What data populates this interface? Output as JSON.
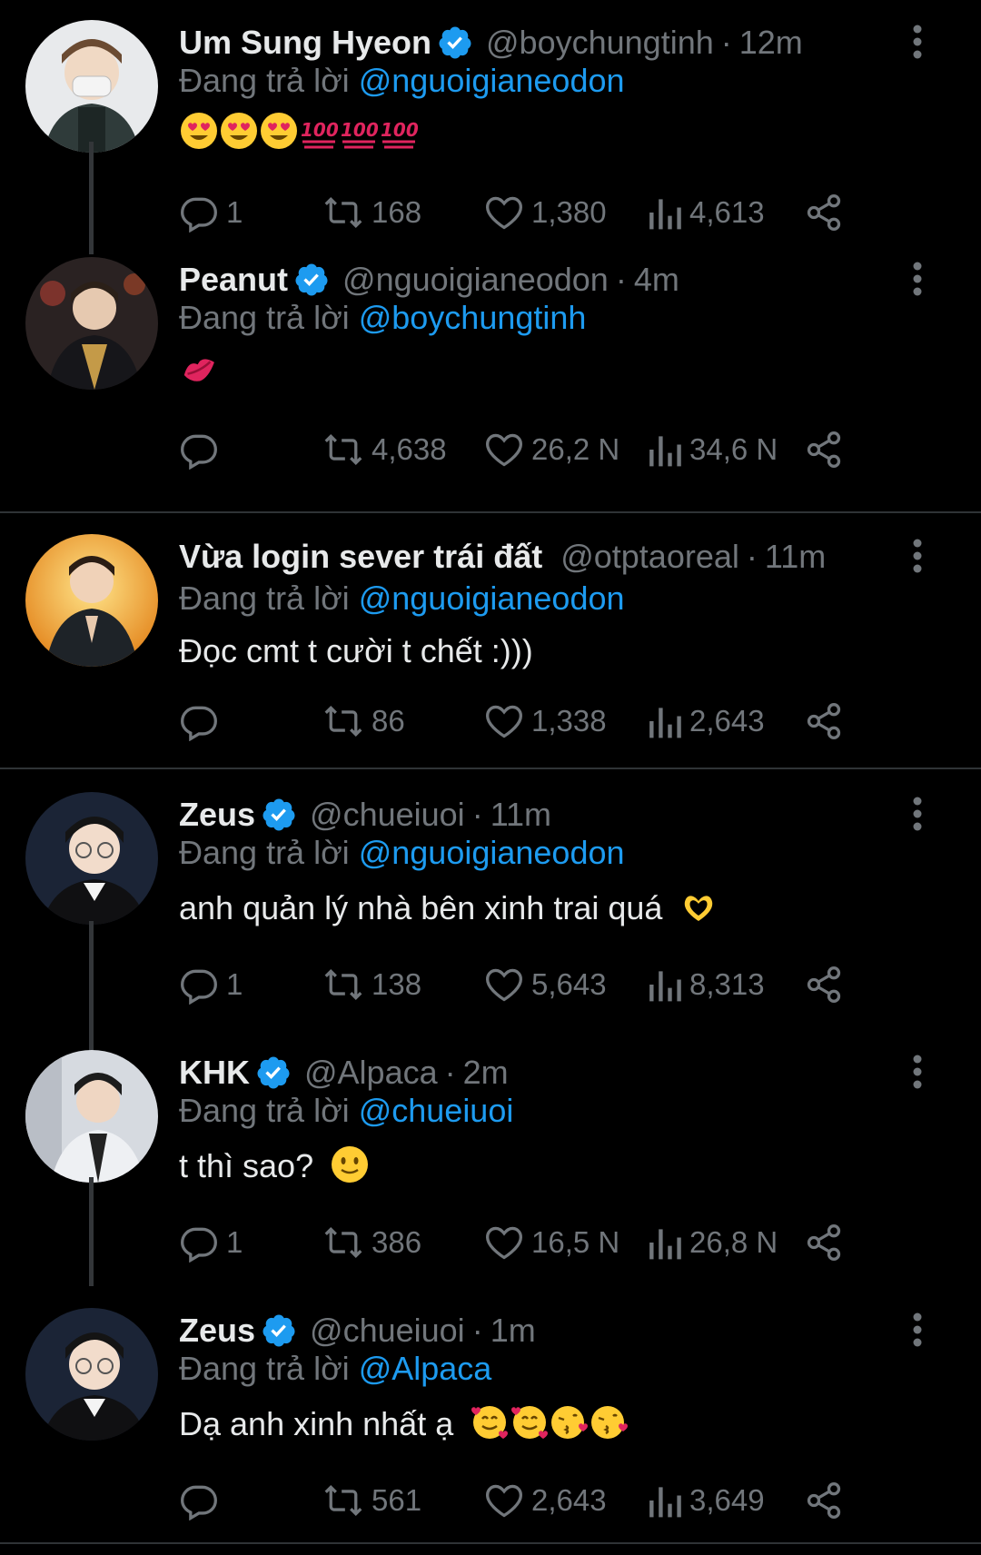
{
  "tweets": [
    {
      "name": "Um Sung Hyeon",
      "verified": true,
      "handle": "@boychungtinh",
      "sep": "·",
      "time": "12m",
      "replying_prefix": "Đang trả lời",
      "replying_to": "@nguoigianeodon",
      "content": "",
      "content_emojis": [
        "heart-eyes",
        "heart-eyes",
        "heart-eyes",
        "hundred",
        "hundred",
        "hundred"
      ],
      "replies": "1",
      "retweets": "168",
      "likes": "1,380",
      "views": "4,613",
      "avatar_color": "#cfd3d6"
    },
    {
      "name": "Peanut",
      "verified": true,
      "handle": "@nguoigianeodon",
      "sep": "·",
      "time": "4m",
      "replying_prefix": "Đang trả lời",
      "replying_to": "@boychungtinh",
      "content": "",
      "content_emojis": [
        "kiss-lips"
      ],
      "replies": "",
      "retweets": "4,638",
      "likes": "26,2 N",
      "views": "34,6 N",
      "avatar_color": "#3a2f2c"
    },
    {
      "name": "Vừa login sever trái đất",
      "verified": false,
      "handle": "@otptaoreal",
      "sep": "·",
      "time": "11m",
      "replying_prefix": "Đang trả lời",
      "replying_to": "@nguoigianeodon",
      "content": "Đọc cmt t cười t chết :)))",
      "content_emojis": [],
      "replies": "",
      "retweets": "86",
      "likes": "1,338",
      "views": "2,643",
      "avatar_color": "#e9a12a"
    },
    {
      "name": "Zeus",
      "verified": true,
      "handle": "@chueiuoi",
      "sep": "·",
      "time": "11m",
      "replying_prefix": "Đang trả lời",
      "replying_to": "@nguoigianeodon",
      "content": "anh quản lý nhà bên xinh trai quá",
      "content_emojis": [
        "heart-hands"
      ],
      "replies": "1",
      "retweets": "138",
      "likes": "5,643",
      "views": "8,313",
      "avatar_color": "#1f2a3d"
    },
    {
      "name": "KHK",
      "verified": true,
      "handle": "@Alpaca",
      "sep": "·",
      "time": "2m",
      "replying_prefix": "Đang trả lời",
      "replying_to": "@chueiuoi",
      "content": "t thì sao?",
      "content_emojis": [
        "slight-smile"
      ],
      "replies": "1",
      "retweets": "386",
      "likes": "16,5 N",
      "views": "26,8 N",
      "avatar_color": "#d9dde3"
    },
    {
      "name": "Zeus",
      "verified": true,
      "handle": "@chueiuoi",
      "sep": "·",
      "time": "1m",
      "replying_prefix": "Đang trả lời",
      "replying_to": "@Alpaca",
      "content": "Dạ anh xinh nhất ạ",
      "content_emojis": [
        "smiling-hearts",
        "smiling-hearts",
        "kissing-heart",
        "kissing-heart"
      ],
      "replies": "",
      "retweets": "561",
      "likes": "2,643",
      "views": "3,649",
      "avatar_color": "#1f2a3d"
    }
  ],
  "colors": {
    "background": "#000000",
    "text": "#e7e9ea",
    "muted": "#71767b",
    "link": "#1d9bf0",
    "divider": "#2f3336"
  }
}
